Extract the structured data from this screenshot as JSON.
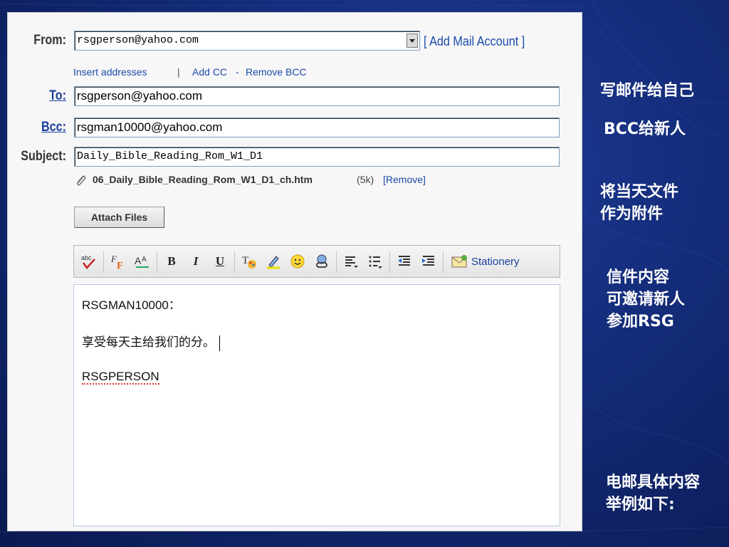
{
  "form": {
    "from_label": "From:",
    "from_value": "rsgperson@yahoo.com",
    "add_account_link": "[ Add Mail Account ]",
    "insert_addresses": "Insert addresses",
    "pipe": "|",
    "add_cc": "Add CC",
    "dash": "-",
    "remove_bcc": "Remove BCC",
    "to_label": "To:",
    "to_value": "rsgperson@yahoo.com",
    "bcc_label": "Bcc:",
    "bcc_value": "rsgman10000@yahoo.com",
    "subject_label": "Subject:",
    "subject_value": "Daily_Bible_Reading_Rom_W1_D1",
    "attachment_name": "06_Daily_Bible_Reading_Rom_W1_D1_ch.htm",
    "attachment_size": "(5k)",
    "attachment_remove": "[Remove]",
    "attach_button": "Attach Files"
  },
  "toolbar": {
    "stationery_label": "Stationery",
    "bold": "B",
    "italic": "I",
    "underline": "U"
  },
  "editor": {
    "line1": "RSGMAN10000：",
    "line2": "享受每天主给我们的分。",
    "line3": "RSGPERSON"
  },
  "notes": {
    "note1": "写邮件给自己",
    "note2": "BCC给新人",
    "note3_l1": "将当天文件",
    "note3_l2": "作为附件",
    "note4_l1": "信件内容",
    "note4_l2": "可邀请新人",
    "note4_l3": "参加RSG",
    "note5_l1": "电邮具体内容",
    "note5_l2": "举例如下:"
  }
}
